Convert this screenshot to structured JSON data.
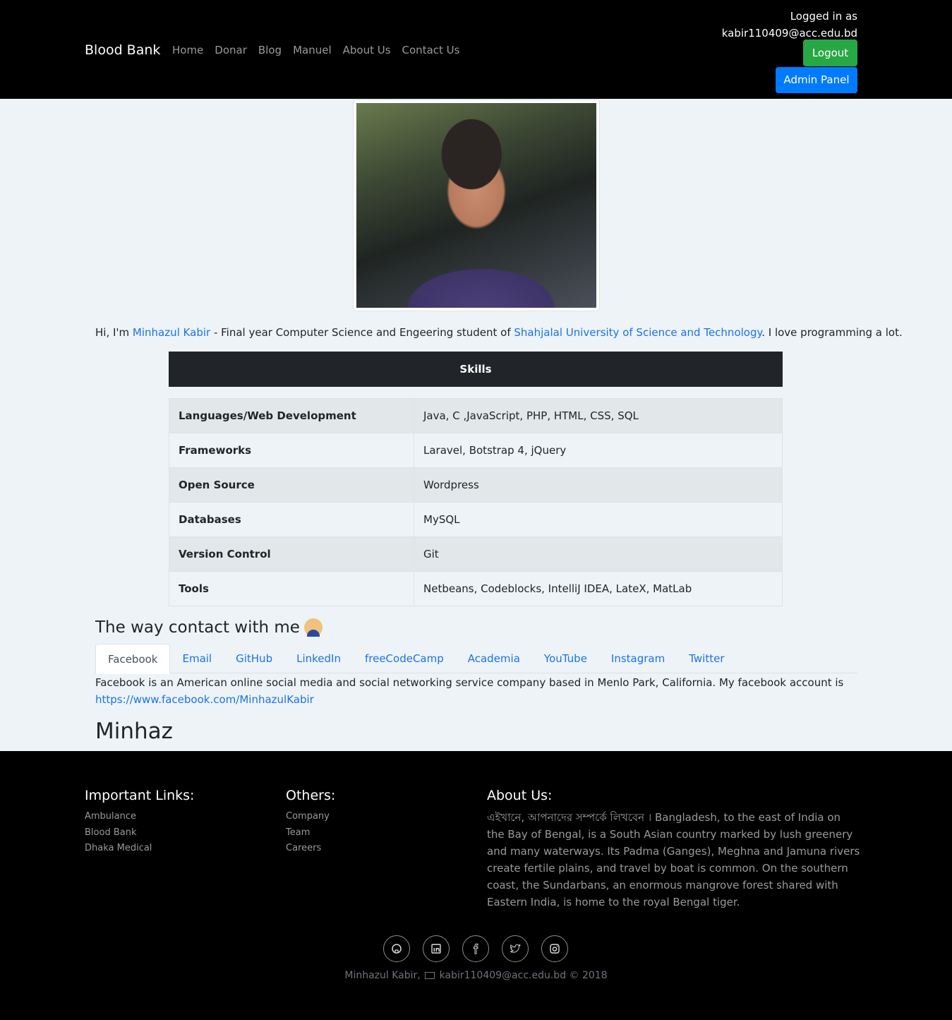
{
  "nav": {
    "brand": "Blood Bank",
    "links": [
      "Home",
      "Donar",
      "Blog",
      "Manuel",
      "About Us",
      "Contact Us"
    ],
    "logged_in_label": "Logged in as",
    "logged_in_email": "kabir110409@acc.edu.bd",
    "logout": "Logout",
    "admin_panel": "Admin Panel"
  },
  "intro": {
    "prefix": "Hi, I'm ",
    "name": "Minhazul Kabir",
    "middle": " - Final year Computer Science and Engeering student of ",
    "university": "Shahjalal University of Science and Technology",
    "suffix": ". I love programming a lot."
  },
  "skills": {
    "title": "Skills",
    "rows": [
      {
        "k": "Languages/Web Development",
        "v": "Java, C ,JavaScript, PHP, HTML, CSS, SQL"
      },
      {
        "k": "Frameworks",
        "v": "Laravel, Botstrap 4, jQuery"
      },
      {
        "k": "Open Source",
        "v": "Wordpress"
      },
      {
        "k": "Databases",
        "v": "MySQL"
      },
      {
        "k": "Version Control",
        "v": "Git"
      },
      {
        "k": "Tools",
        "v": "Netbeans, Codeblocks, IntelliJ IDEA, LateX, MatLab"
      }
    ]
  },
  "contact": {
    "heading": "The way contact with me",
    "tabs": [
      "Facebook",
      "Email",
      "GitHub",
      "LinkedIn",
      "freeCodeCamp",
      "Academia",
      "YouTube",
      "Instagram",
      "Twitter"
    ],
    "active_tab": "Facebook",
    "content_text": "Facebook is an American online social media and social networking service company based in Menlo Park, California. My facebook account is",
    "content_link": "https://www.facebook.com/MinhazulKabir",
    "name_heading": "Minhaz"
  },
  "footer": {
    "important_title": "Important Links:",
    "important_links": [
      "Ambulance",
      "Blood Bank",
      "Dhaka Medical"
    ],
    "others_title": "Others:",
    "others_links": [
      "Company",
      "Team",
      "Careers"
    ],
    "about_title": "About Us:",
    "about_text": "এইখানে, আপনাদের সম্পর্কে লিখবেন । Bangladesh, to the east of India on the Bay of Bengal, is a South Asian country marked by lush greenery and many waterways. Its Padma (Ganges), Meghna and Jamuna rivers create fertile plains, and travel by boat is common. On the southern coast, the Sundarbans, an enormous mangrove forest shared with Eastern India, is home to the royal Bengal tiger.",
    "social_icons": [
      "github-icon",
      "linkedin-icon",
      "facebook-icon",
      "twitter-icon",
      "instagram-icon"
    ],
    "copyright_name": "Minhazul Kabir,",
    "copyright_email": "kabir110409@acc.edu.bd",
    "copyright_year": "© 2018"
  }
}
